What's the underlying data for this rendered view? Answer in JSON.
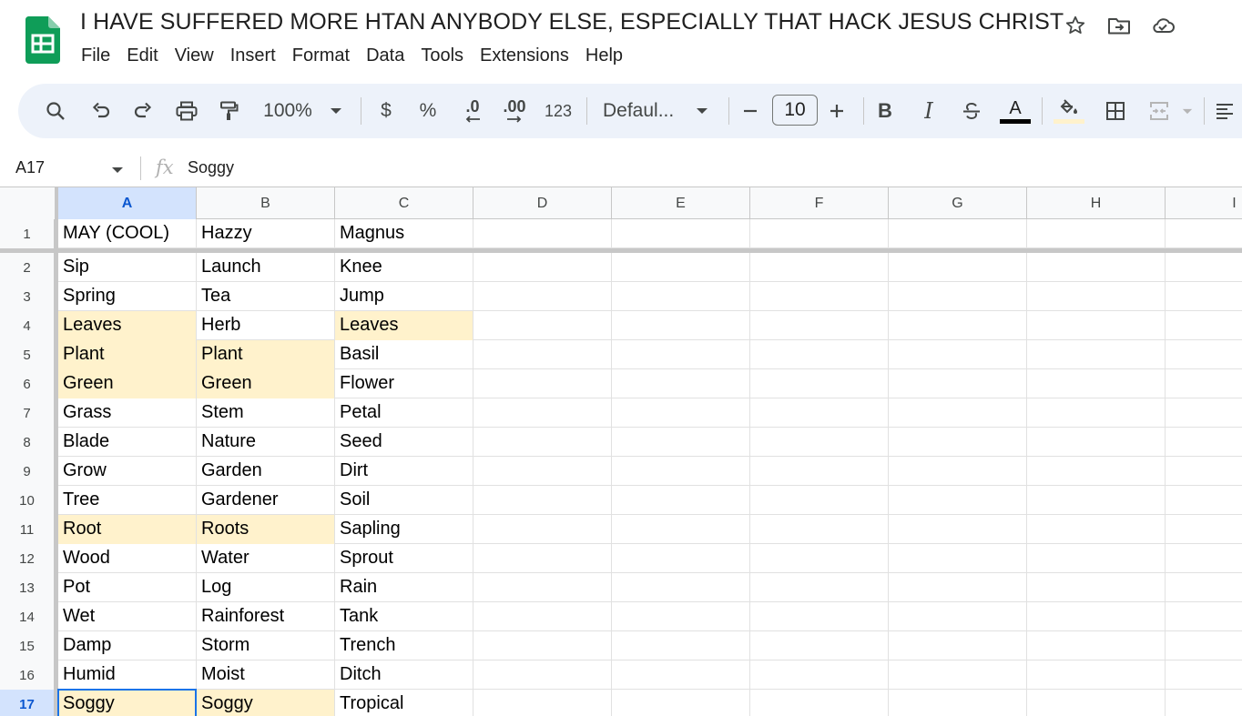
{
  "app": {
    "logo_icon": "google-sheets-logo",
    "doc_title": "I HAVE SUFFERED MORE HTAN ANYBODY ELSE, ESPECIALLY THAT HACK JESUS CHRIST",
    "title_icons": [
      "star-icon",
      "move-to-folder-icon",
      "cloud-saved-icon"
    ]
  },
  "menu": [
    "File",
    "Edit",
    "View",
    "Insert",
    "Format",
    "Data",
    "Tools",
    "Extensions",
    "Help"
  ],
  "toolbar": {
    "zoom": "100%",
    "currency": "$",
    "percent": "%",
    "decrease_decimal": ".0",
    "increase_decimal": ".00",
    "more_formats": "123",
    "font_family": "Defaul...",
    "font_size": "10",
    "bold": "B",
    "italic": "I",
    "text_color_letter": "A",
    "text_color": "#000000",
    "fill_color": "#fff2cc",
    "highlight_color": "#fff2cc",
    "selection_color": "#1a73e8"
  },
  "formula_bar": {
    "name_box": "A17",
    "fx": "fx",
    "value": "Soggy"
  },
  "columns": [
    "A",
    "B",
    "C",
    "D",
    "E",
    "F",
    "G",
    "H",
    "I"
  ],
  "active_column": "A",
  "rows": [
    {
      "num": "1",
      "cells": [
        "MAY (COOL)",
        "Hazzy",
        "Magnus"
      ],
      "hl": [
        false,
        false,
        false
      ]
    },
    {
      "num": "2",
      "cells": [
        "Sip",
        "Launch",
        "Knee"
      ],
      "hl": [
        false,
        false,
        false
      ]
    },
    {
      "num": "3",
      "cells": [
        "Spring",
        "Tea",
        "Jump"
      ],
      "hl": [
        false,
        false,
        false
      ]
    },
    {
      "num": "4",
      "cells": [
        "Leaves",
        "Herb",
        "Leaves"
      ],
      "hl": [
        true,
        false,
        true
      ]
    },
    {
      "num": "5",
      "cells": [
        "Plant",
        "Plant",
        "Basil"
      ],
      "hl": [
        true,
        true,
        false
      ]
    },
    {
      "num": "6",
      "cells": [
        "Green",
        "Green",
        "Flower"
      ],
      "hl": [
        true,
        true,
        false
      ]
    },
    {
      "num": "7",
      "cells": [
        "Grass",
        "Stem",
        "Petal"
      ],
      "hl": [
        false,
        false,
        false
      ]
    },
    {
      "num": "8",
      "cells": [
        "Blade",
        "Nature",
        "Seed"
      ],
      "hl": [
        false,
        false,
        false
      ]
    },
    {
      "num": "9",
      "cells": [
        "Grow",
        "Garden",
        "Dirt"
      ],
      "hl": [
        false,
        false,
        false
      ]
    },
    {
      "num": "10",
      "cells": [
        "Tree",
        "Gardener",
        "Soil"
      ],
      "hl": [
        false,
        false,
        false
      ]
    },
    {
      "num": "11",
      "cells": [
        "Root",
        "Roots",
        "Sapling"
      ],
      "hl": [
        true,
        true,
        false
      ]
    },
    {
      "num": "12",
      "cells": [
        "Wood",
        "Water",
        "Sprout"
      ],
      "hl": [
        false,
        false,
        false
      ]
    },
    {
      "num": "13",
      "cells": [
        "Pot",
        "Log",
        "Rain"
      ],
      "hl": [
        false,
        false,
        false
      ]
    },
    {
      "num": "14",
      "cells": [
        "Wet",
        "Rainforest",
        "Tank"
      ],
      "hl": [
        false,
        false,
        false
      ]
    },
    {
      "num": "15",
      "cells": [
        "Damp",
        "Storm",
        "Trench"
      ],
      "hl": [
        false,
        false,
        false
      ]
    },
    {
      "num": "16",
      "cells": [
        "Humid",
        "Moist",
        "Ditch"
      ],
      "hl": [
        false,
        false,
        false
      ]
    },
    {
      "num": "17",
      "cells": [
        "Soggy",
        "Soggy",
        "Tropical"
      ],
      "hl": [
        true,
        true,
        false
      ]
    }
  ],
  "active_row": "17"
}
